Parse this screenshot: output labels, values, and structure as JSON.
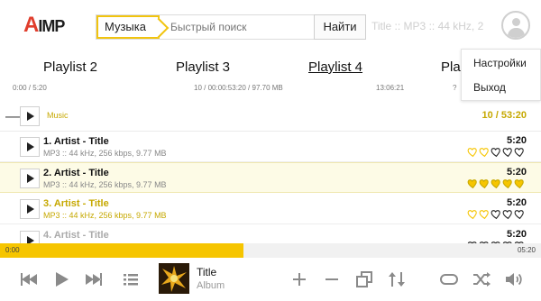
{
  "app": {
    "logo_letter": "A",
    "logo_rest": "IMP"
  },
  "search": {
    "category": "Музыка",
    "placeholder": "Быстрый поиск",
    "button": "Найти"
  },
  "now_info": "Title :: MP3 :: 44 kHz, 2",
  "user_menu": {
    "items": [
      "Настройки",
      "Выход"
    ]
  },
  "tabs": [
    {
      "label": "Playlist 2",
      "stats": "0:00 / 5:20"
    },
    {
      "label": "Playlist 3",
      "stats": "10 / 00:00:53:20 / 97.70 MB"
    },
    {
      "label": "Playlist 4",
      "stats": "13:06:21",
      "active": true
    },
    {
      "label": "Pla",
      "stats": "?"
    }
  ],
  "group": {
    "name": "Music",
    "stats": "10 / 53:20"
  },
  "tracks": [
    {
      "title": "1. Artist - Title",
      "meta": "MP3 :: 44 kHz, 256 kbps, 9.77 MB",
      "duration": "5:20",
      "rating": 2
    },
    {
      "title": "2. Artist - Title",
      "meta": "MP3 :: 44 kHz, 256 kbps, 9.77 MB",
      "duration": "5:20",
      "rating": 5
    },
    {
      "title": "3. Artist - Title",
      "meta": "MP3 :: 44 kHz, 256 kbps, 9.77 MB",
      "duration": "5:20",
      "rating": 2
    },
    {
      "title": "4. Artist - Title",
      "meta": "",
      "duration": "5:20",
      "rating": 0
    }
  ],
  "progress": {
    "elapsed": "0:00",
    "total": "05:20",
    "fraction": 0.45
  },
  "now_playing": {
    "title": "Title",
    "album": "Album"
  },
  "colors": {
    "accent": "#f6c500",
    "accent_text": "#c6a800",
    "logo_red": "#e03e2d",
    "icon_gray": "#8a8a8a"
  },
  "icons": [
    "prev-icon",
    "play-icon",
    "next-icon",
    "playlist-icon",
    "add-icon",
    "remove-icon",
    "copy-icon",
    "sort-icon",
    "repeat-icon",
    "shuffle-icon",
    "volume-icon"
  ]
}
